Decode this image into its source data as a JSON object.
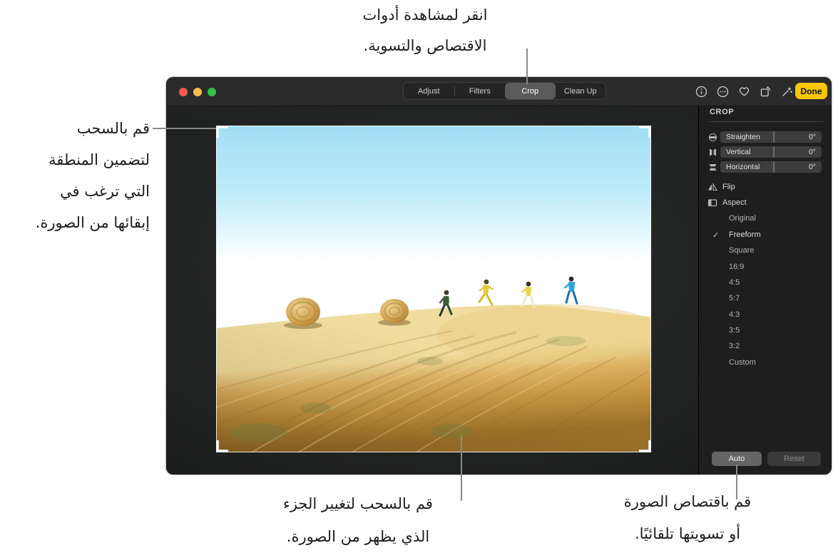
{
  "annotations": {
    "top": {
      "lines": [
        "انقر لمشاهدة أدوات",
        "الاقتصاص والتسوية."
      ]
    },
    "left": {
      "lines": [
        "قم بالسحب",
        "لتضمين المنطقة",
        "التي ترغب في",
        "إبقائها من الصورة."
      ]
    },
    "bottom_center": {
      "lines": [
        "قم بالسحب لتغيير الجزء",
        "الذي يظهر من الصورة."
      ]
    },
    "bottom_right": {
      "lines": [
        "قم باقتصاص الصورة",
        "أو تسويتها تلقائيًا."
      ]
    }
  },
  "window": {
    "toolbar": {
      "tabs": [
        {
          "label": "Adjust",
          "selected": false
        },
        {
          "label": "Filters",
          "selected": false
        },
        {
          "label": "Crop",
          "selected": true
        },
        {
          "label": "Clean Up",
          "selected": false
        }
      ],
      "done_label": "Done"
    },
    "sidebar": {
      "title": "CROP",
      "sliders": [
        {
          "label": "Straighten",
          "value": "0°"
        },
        {
          "label": "Vertical",
          "value": "0°"
        },
        {
          "label": "Horizontal",
          "value": "0°"
        }
      ],
      "flip_label": "Flip",
      "aspect_label": "Aspect",
      "aspect_options": [
        {
          "label": "Original",
          "checked": false
        },
        {
          "label": "Freeform",
          "checked": true
        },
        {
          "label": "Square",
          "checked": false
        },
        {
          "label": "16:9",
          "checked": false
        },
        {
          "label": "4:5",
          "checked": false
        },
        {
          "label": "5:7",
          "checked": false
        },
        {
          "label": "4:3",
          "checked": false
        },
        {
          "label": "3:5",
          "checked": false
        },
        {
          "label": "3:2",
          "checked": false
        },
        {
          "label": "Custom",
          "checked": false
        }
      ],
      "auto_label": "Auto",
      "reset_label": "Reset"
    }
  },
  "icons": {
    "checkmark": "✓"
  },
  "colors": {
    "done-yellow": "#f7c600",
    "titlebar-bg": "#2b2b2b",
    "sidebar-bg": "#1e1e1e",
    "field-bg": "#3e3e3e",
    "segment-selected": "#5a5a5a",
    "auto-btn": "#656565",
    "callout-line": "#8a8a8a",
    "annotation-text": "#1c1c1c",
    "tl-red": "#f85a52",
    "tl-yellow": "#f5bf4f",
    "tl-green": "#2fc642"
  }
}
